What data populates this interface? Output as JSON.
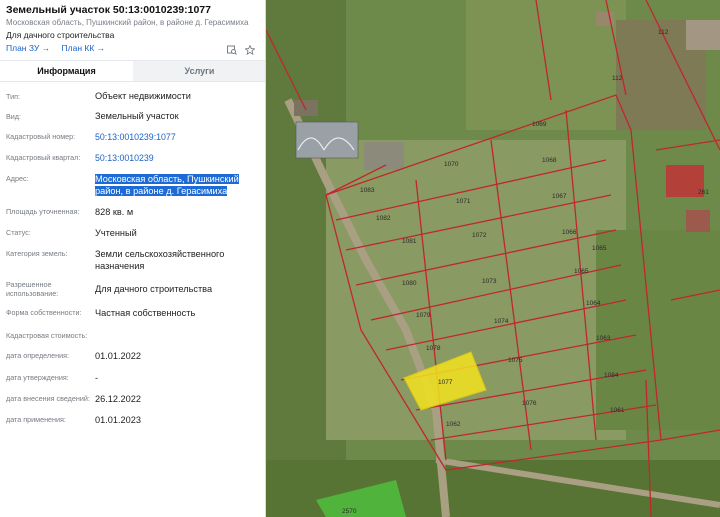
{
  "header": {
    "title": "Земельный участок 50:13:0010239:1077",
    "address": "Московская область, Пушкинский район, в районе д. Герасимиха",
    "use": "Для дачного строительства",
    "links": [
      "План ЗУ →",
      "План КК →"
    ]
  },
  "tabs": [
    "Информация",
    "Услуги"
  ],
  "rows": [
    {
      "label": "Тип:",
      "value": "Объект недвижимости"
    },
    {
      "label": "Вид:",
      "value": "Земельный участок"
    },
    {
      "label": "Кадастровый номер:",
      "value": "50:13:0010239:1077"
    },
    {
      "label": "Кадастровый квартал:",
      "value": "50:13:0010239"
    },
    {
      "label": "Адрес:",
      "value": "Московская область, Пушкинский район, в районе д. Герасимиха"
    },
    {
      "label": "Площадь уточненная:",
      "value": "828 кв. м"
    },
    {
      "label": "Статус:",
      "value": "Учтенный"
    },
    {
      "label": "Категория земель:",
      "value": "Земли сельскохозяйственного назначения"
    },
    {
      "label": "Разрешенное использование:",
      "value": "Для дачного строительства"
    },
    {
      "label": "Форма собственности:",
      "value": "Частная собственность"
    },
    {
      "label": "Кадастровая стоимость:",
      "value": ""
    },
    {
      "label": "дата определения:",
      "value": "01.01.2022"
    },
    {
      "label": "дата утверждения:",
      "value": "-"
    },
    {
      "label": "дата внесения сведений:",
      "value": "26.12.2022"
    },
    {
      "label": "дата применения:",
      "value": "01.01.2023"
    }
  ],
  "map": {
    "plot_labels": [
      "1069",
      "1070",
      "1068",
      "1083",
      "1071",
      "1067",
      "1082",
      "1072",
      "1066",
      "1081",
      "1065",
      "1073",
      "1080",
      "1065",
      "1064",
      "1079",
      "1074",
      "1063",
      "1078",
      "1075",
      "1077",
      "1084",
      "1076",
      "1062",
      "1061",
      "112",
      "112",
      "261",
      "2570"
    ],
    "selected_plot": "1077",
    "colors": {
      "boundary": "#c0272d",
      "selected": "#f2e21e",
      "grass": "#6f8a4b"
    }
  }
}
